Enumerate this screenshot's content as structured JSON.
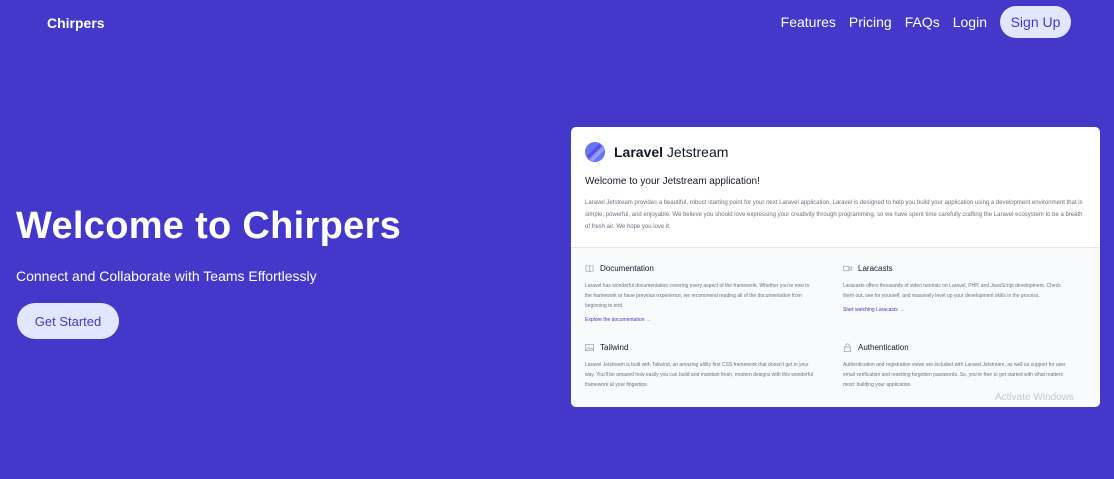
{
  "nav": {
    "brand": "Chirpers",
    "links": [
      "Features",
      "Pricing",
      "FAQs",
      "Login"
    ],
    "signup": "Sign Up"
  },
  "hero": {
    "title": "Welcome to Chirpers",
    "subtitle": "Connect and Collaborate with Teams Effortlessly",
    "cta": "Get Started"
  },
  "preview": {
    "logo_bold": "Laravel",
    "logo_light": " Jetstream",
    "welcome": "Welcome to your Jetstream application!",
    "intro": "Laravel Jetstream provides a beautiful, robust starting point for your next Laravel application. Laravel is designed to help you build your application using a development environment that is simple, powerful, and enjoyable. We believe you should love expressing your creativity through programming, so we have spent time carefully crafting the Laravel ecosystem to be a breath of fresh air. We hope you love it.",
    "features": [
      {
        "title": "Documentation",
        "icon": "book-icon",
        "body": "Laravel has wonderful documentation covering every aspect of the framework. Whether you're new to the framework or have previous experience, we recommend reading all of the documentation from beginning to end.",
        "link": "Explore the documentation →"
      },
      {
        "title": "Laracasts",
        "icon": "video-icon",
        "body": "Laracasts offers thousands of video tutorials on Laravel, PHP, and JavaScript development. Check them out, see for yourself, and massively level up your development skills in the process.",
        "link": "Start watching Laracasts →"
      },
      {
        "title": "Tailwind",
        "icon": "image-icon",
        "body": "Laravel Jetstream is built with Tailwind, an amazing utility first CSS framework that doesn't get in your way. You'll be amazed how easily you can build and maintain fresh, modern designs with this wonderful framework at your fingertips.",
        "link": ""
      },
      {
        "title": "Authentication",
        "icon": "lock-icon",
        "body": "Authentication and registration views are included with Laravel Jetstream, as well as support for user email verification and resetting forgotten passwords. So, you're free to get started with what matters most: building your application.",
        "link": ""
      }
    ]
  },
  "watermark": "Activate Windows"
}
